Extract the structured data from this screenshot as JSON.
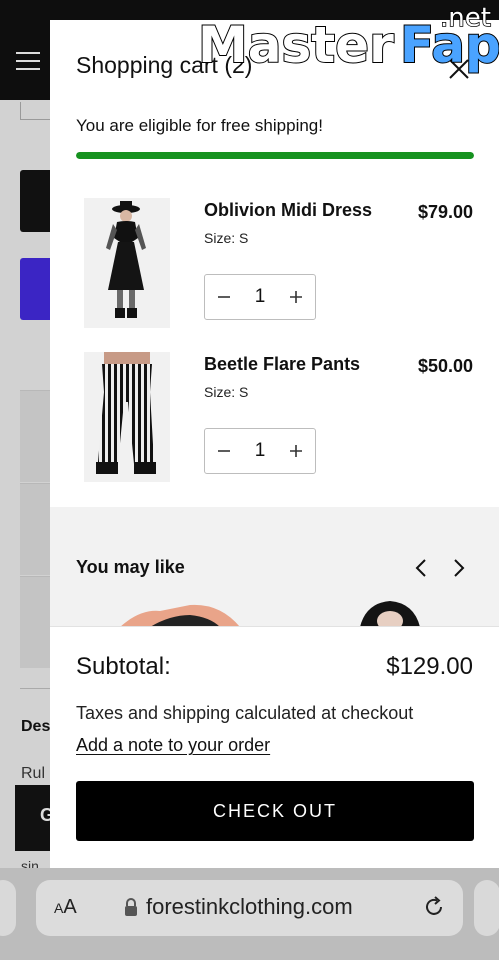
{
  "background_page": {
    "desc_label": "Des",
    "rule_label": "Rul",
    "swatch_letter": "G",
    "small_text": "sin"
  },
  "cart": {
    "title": "Shopping cart (2)",
    "free_shipping_text": "You are eligible for free shipping!",
    "free_shipping_progress": 1.0,
    "progress_color": "#16921f",
    "items": [
      {
        "name": "Oblivion Midi Dress",
        "size": "Size: S",
        "price": "$79.00",
        "quantity": "1",
        "image": "black-midi-dress-photo"
      },
      {
        "name": "Beetle Flare Pants",
        "size": "Size: S",
        "price": "$50.00",
        "quantity": "1",
        "image": "striped-flare-pants-photo"
      }
    ],
    "you_may_like": {
      "title": "You may like"
    },
    "subtotal_label": "Subtotal:",
    "subtotal_value": "$129.00",
    "taxes_note": "Taxes and shipping calculated at checkout",
    "add_note_link": "Add a note to your order",
    "checkout_button": "CHECK OUT"
  },
  "browser": {
    "text_size_label_small": "A",
    "text_size_label_large": "A",
    "url": "forestinkclothing.com"
  },
  "watermark": {
    "part1": "Master",
    "part2": "Fap",
    "part3": ".net"
  },
  "icons": {
    "menu": "hamburger-icon",
    "close": "close-icon",
    "minus": "minus-icon",
    "plus": "plus-icon",
    "prev": "chevron-left-icon",
    "next": "chevron-right-icon",
    "lock": "lock-icon",
    "reload": "reload-icon"
  }
}
